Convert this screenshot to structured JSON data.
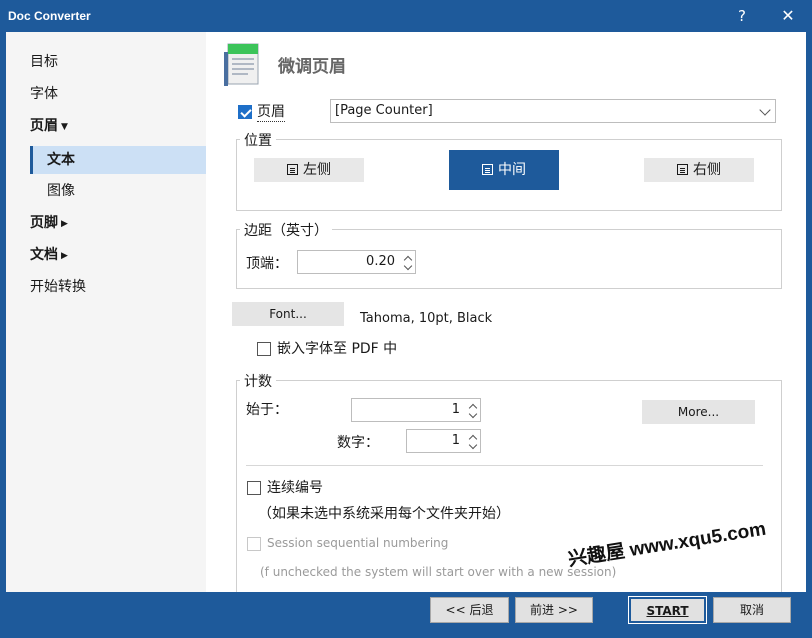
{
  "window": {
    "title": "Doc Converter",
    "help_glyph": "?",
    "close_glyph": "✕"
  },
  "sidebar": {
    "items": [
      {
        "label": "目标"
      },
      {
        "label": "字体"
      },
      {
        "label": "页眉",
        "arrow": "▼"
      },
      {
        "label": "文本"
      },
      {
        "label": "图像"
      },
      {
        "label": "页脚",
        "arrow": "▶"
      },
      {
        "label": "文档",
        "arrow": "▶"
      },
      {
        "label": "开始转换"
      }
    ]
  },
  "main": {
    "page_title": "微调页眉",
    "header_checkbox_label": "页眉",
    "header_checked": true,
    "header_select_value": "[Page Counter]",
    "position": {
      "group_label": "位置",
      "left": "左侧",
      "center": "中间",
      "right": "右侧",
      "selected": "中间"
    },
    "margin": {
      "group_label": "边距（英寸）",
      "top_label": "顶端：",
      "top_value": "0.20"
    },
    "font": {
      "button_label": "Font...",
      "description": "Tahoma, 10pt, Black",
      "embed_label": "嵌入字体至 PDF 中",
      "embed_checked": false
    },
    "counter": {
      "group_label": "计数",
      "start_label": "始于：",
      "start_value": "1",
      "digits_label": "数字：",
      "digits_value": "1",
      "more_button": "More...",
      "continuous_label": "连续编号",
      "continuous_checked": false,
      "continuous_note": "（如果未选中系统采用每个文件夹开始）",
      "session_label": "Session sequential numbering",
      "session_note": "(f unchecked the system will start over with a new session)"
    }
  },
  "footer": {
    "back": "<< 后退",
    "next": "前进 >>",
    "start": "START",
    "cancel": "取消"
  },
  "watermark": {
    "text": "兴趣屋 www.xqu5.com"
  },
  "colors": {
    "accent": "#1e5a9b",
    "selected_bg": "#cce0f5",
    "sidebar_bg": "#f5f5f5"
  }
}
